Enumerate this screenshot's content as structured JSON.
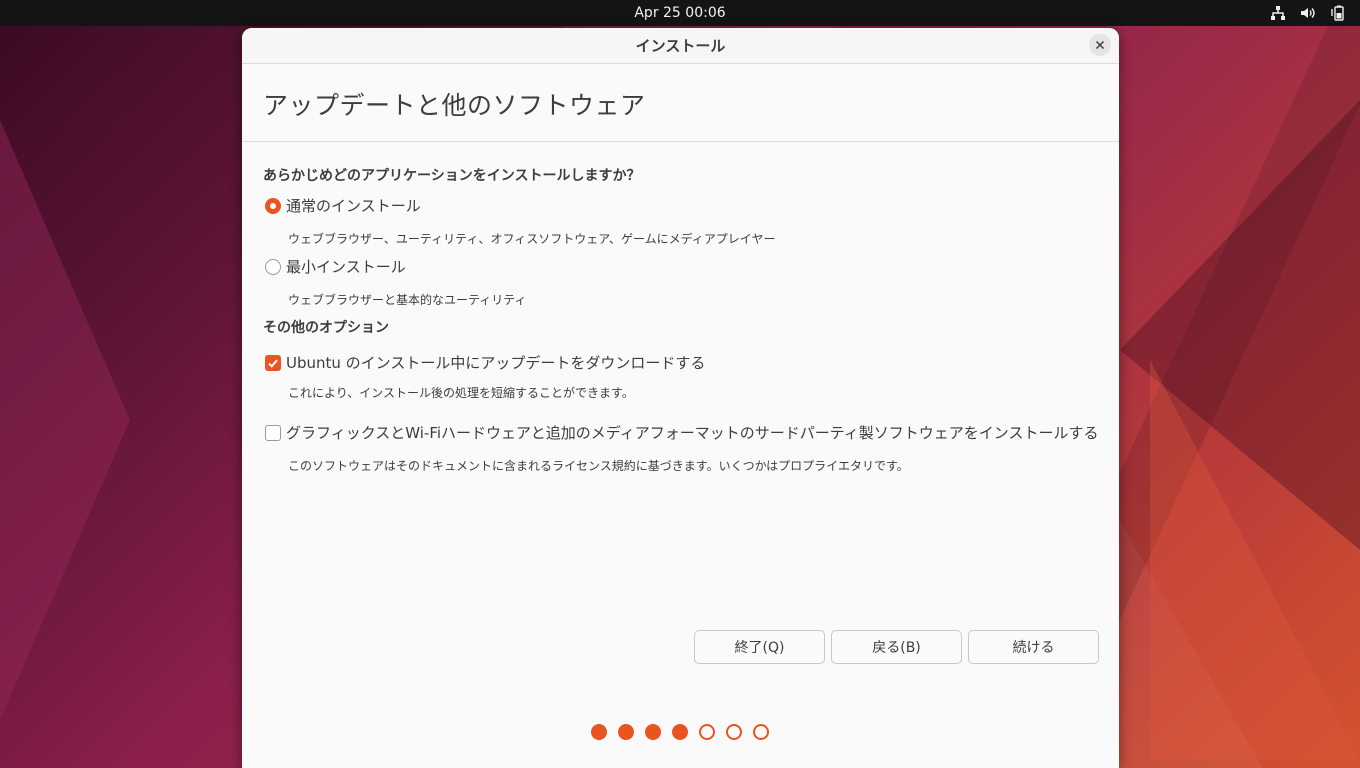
{
  "topbar": {
    "clock": "Apr 25  00:06",
    "tray_icons": [
      "network-icon",
      "volume-icon",
      "battery-icon"
    ]
  },
  "window": {
    "title": "インストール",
    "close_icon": "close-icon",
    "page_title": "アップデートと他のソフトウェア",
    "question": "あらかじめどのアプリケーションをインストールしますか？",
    "install_options": [
      {
        "label": "通常のインストール",
        "description": "ウェブブラウザー、ユーティリティ、オフィスソフトウェア、ゲームにメディアプレイヤー",
        "selected": true
      },
      {
        "label": "最小インストール",
        "description": "ウェブブラウザーと基本的なユーティリティ",
        "selected": false
      }
    ],
    "other_options_title": "その他のオプション",
    "other_options": [
      {
        "label": "Ubuntu のインストール中にアップデートをダウンロードする",
        "description": "これにより、インストール後の処理を短縮することができます。",
        "checked": true
      },
      {
        "label": "グラフィックスとWi-Fiハードウェアと追加のメディアフォーマットのサードパーティ製ソフトウェアをインストールする",
        "description": "このソフトウェアはそのドキュメントに含まれるライセンス規約に基づきます。いくつかはプロプライエタリです。",
        "checked": false
      }
    ],
    "buttons": {
      "quit": "終了(Q)",
      "back": "戻る(B)",
      "continue": "続ける"
    },
    "progress": {
      "completed": 4,
      "total": 7
    }
  },
  "colors": {
    "accent": "#e95420",
    "topbar": "#141414",
    "window_bg": "#fafafa"
  }
}
